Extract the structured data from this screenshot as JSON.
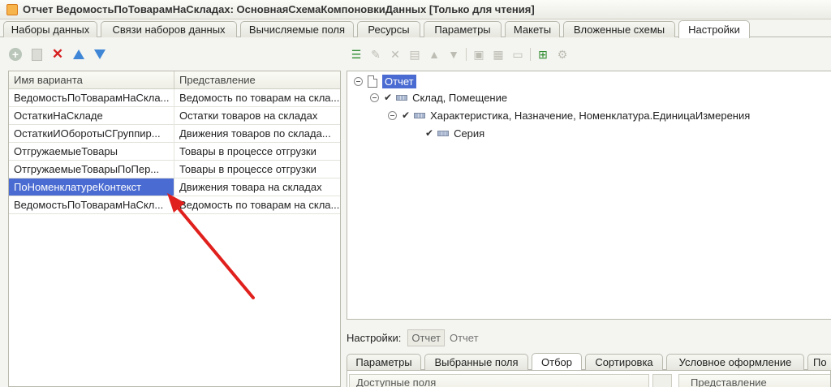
{
  "window": {
    "title": "Отчет ВедомостьПоТоварамНаСкладах: ОсновнаяСхемаКомпоновкиДанных [Только для чтения]"
  },
  "top_tabs": [
    {
      "label": "Наборы данных",
      "active": false
    },
    {
      "label": "Связи наборов данных",
      "active": false
    },
    {
      "label": "Вычисляемые поля",
      "active": false
    },
    {
      "label": "Ресурсы",
      "active": false
    },
    {
      "label": "Параметры",
      "active": false
    },
    {
      "label": "Макеты",
      "active": false
    },
    {
      "label": "Вложенные схемы",
      "active": false
    },
    {
      "label": "Настройки",
      "active": true
    }
  ],
  "variants": {
    "columns": [
      "Имя варианта",
      "Представление"
    ],
    "rows": [
      {
        "name": "ВедомостьПоТоварамНаСкла...",
        "view": "Ведомость по товарам на скла..."
      },
      {
        "name": "ОстаткиНаСкладе",
        "view": "Остатки товаров на складах"
      },
      {
        "name": "ОстаткиИОборотыСГруппир...",
        "view": "Движения товаров по склада..."
      },
      {
        "name": "ОтгружаемыеТовары",
        "view": "Товары в процессе отгрузки"
      },
      {
        "name": "ОтгружаемыеТоварыПоПер...",
        "view": "Товары в процессе отгрузки"
      },
      {
        "name": "ПоНоменклатуреКонтекст",
        "view": "Движения товара на складах",
        "selected": true
      },
      {
        "name": "ВедомостьПоТоварамНаСкл...",
        "view": "Ведомость по товарам на скла..."
      }
    ]
  },
  "tree": {
    "root": "Отчет",
    "level1": "Склад, Помещение",
    "level2": "Характеристика, Назначение, Номенклатура.ЕдиницаИзмерения",
    "level3": "Серия"
  },
  "settings_bar": {
    "label": "Настройки:",
    "chip": "Отчет",
    "value": "Отчет"
  },
  "bottom_tabs": [
    {
      "label": "Параметры",
      "active": false
    },
    {
      "label": "Выбранные поля",
      "active": false
    },
    {
      "label": "Отбор",
      "active": true
    },
    {
      "label": "Сортировка",
      "active": false
    },
    {
      "label": "Условное оформление",
      "active": false
    },
    {
      "label": "По",
      "active": false
    }
  ],
  "bottom_grid": {
    "left_header": "Доступные поля",
    "right_header": "Представление"
  },
  "colors": {
    "selection": "#4a6bd1",
    "annotation_arrow": "#e0201c"
  }
}
